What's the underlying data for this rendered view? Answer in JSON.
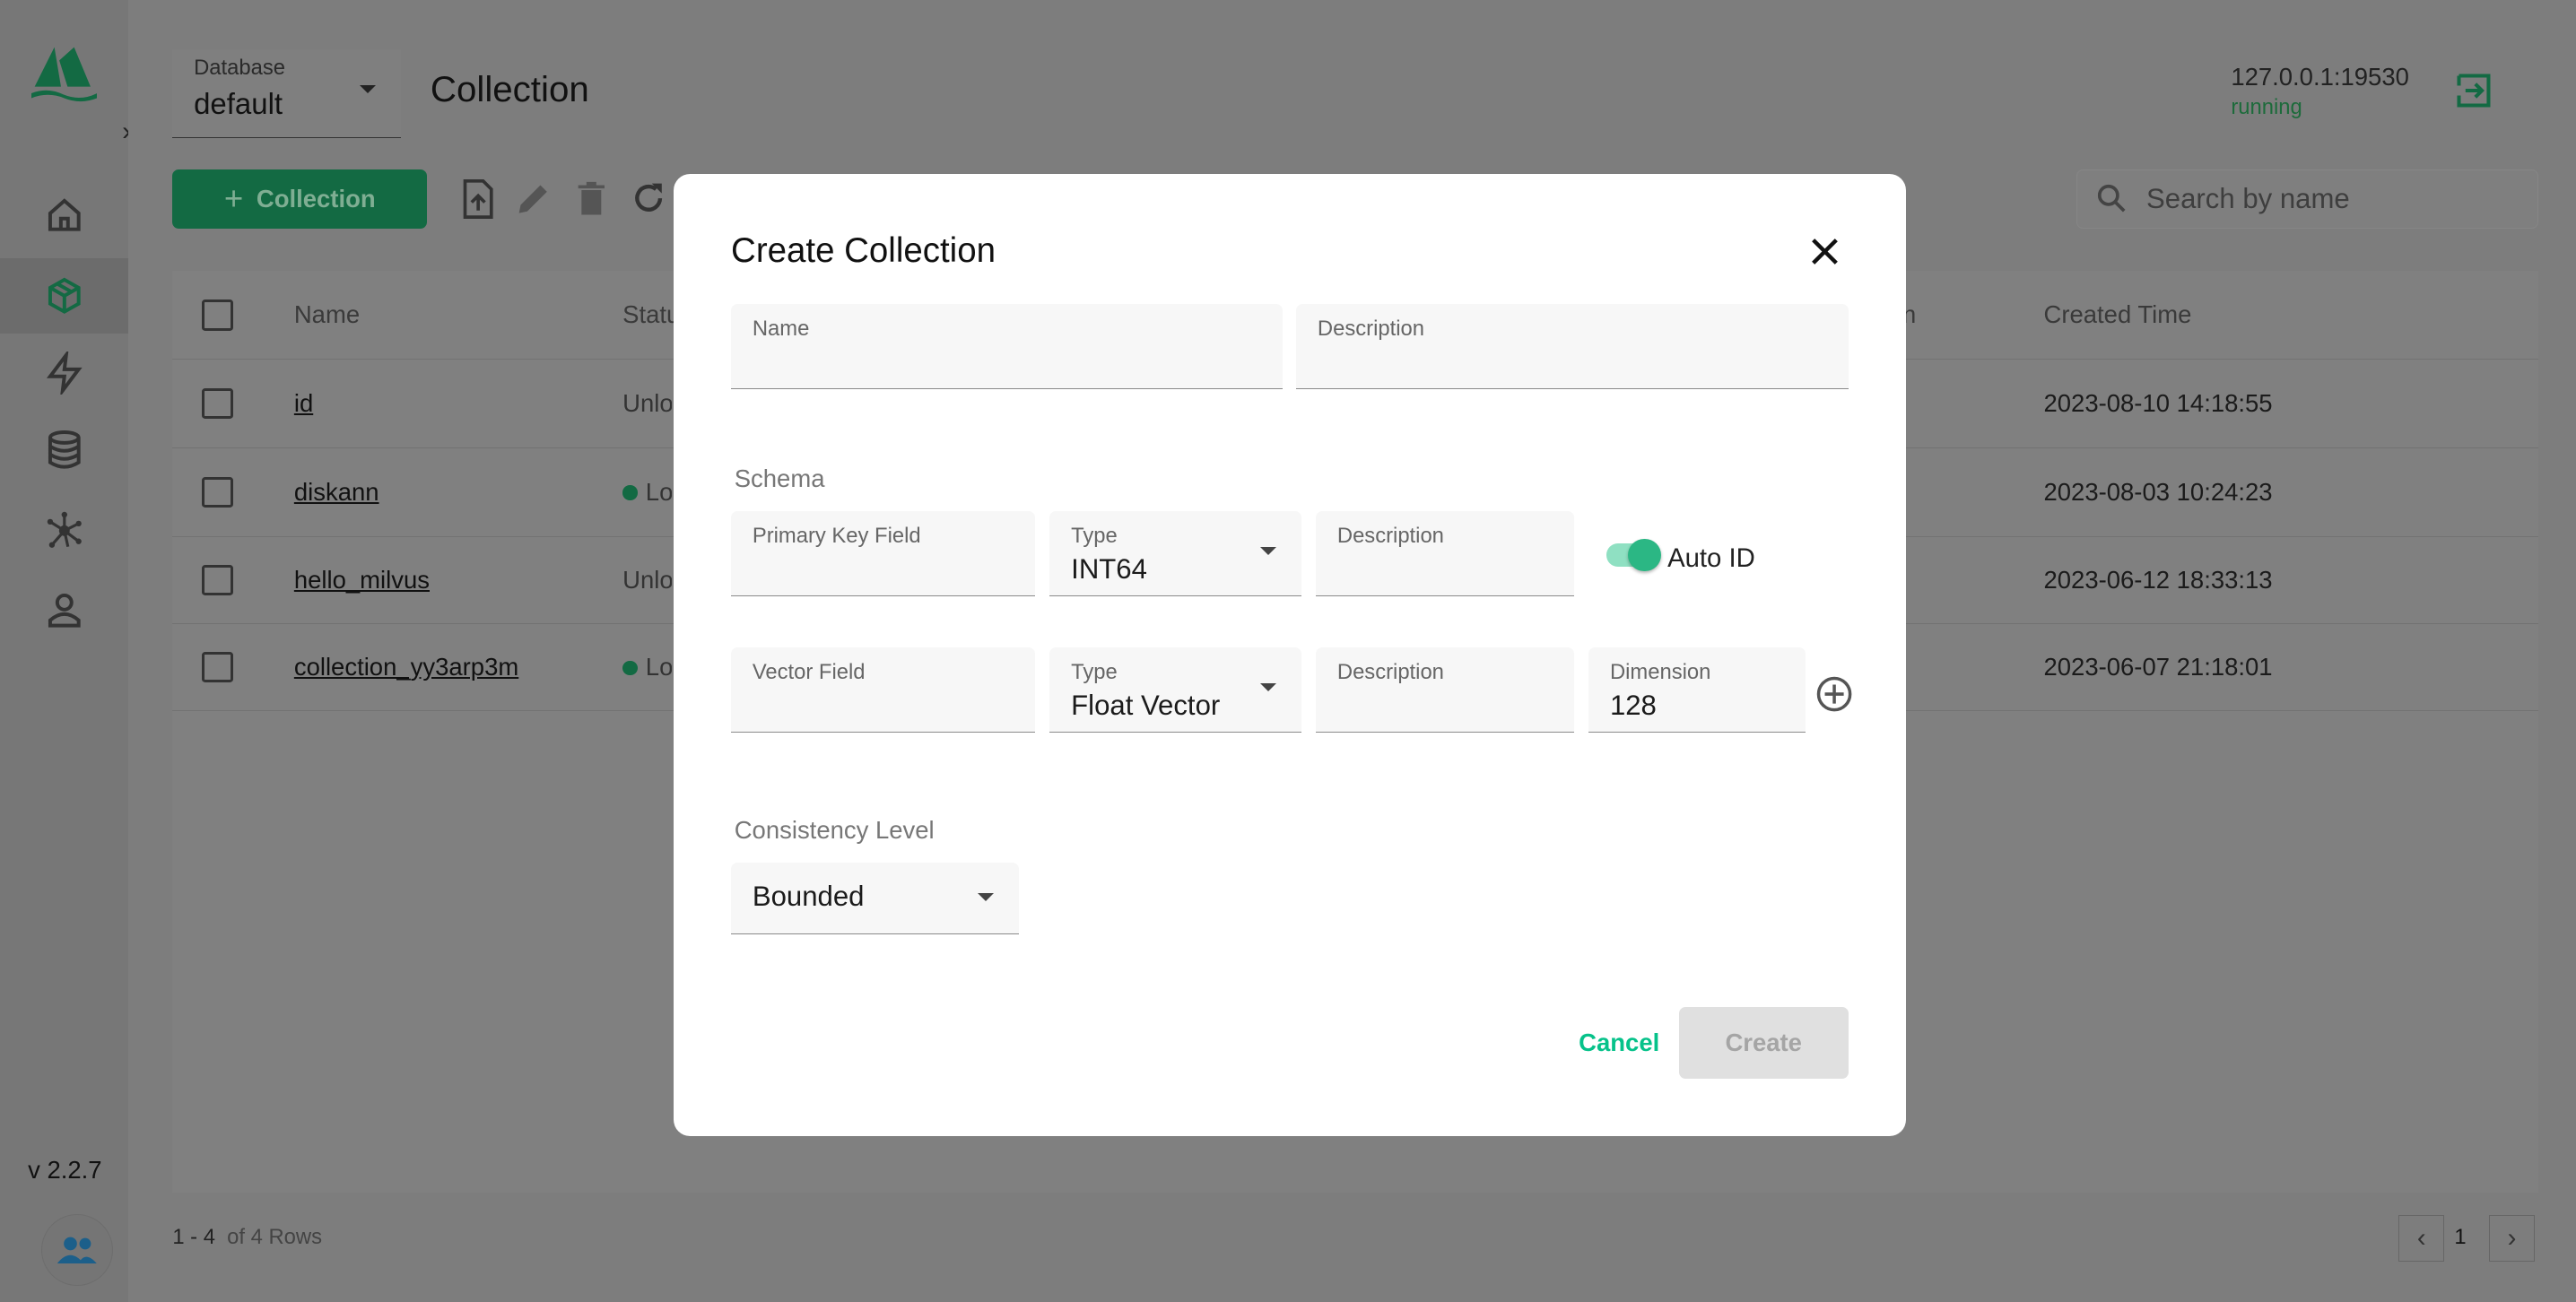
{
  "sidebar": {
    "version": "v 2.2.7",
    "items": [
      "home",
      "collection",
      "search",
      "database",
      "system",
      "user"
    ]
  },
  "header": {
    "database_label": "Database",
    "database_value": "default",
    "title": "Collection",
    "address": "127.0.0.1:19530",
    "status": "running"
  },
  "toolbar": {
    "add_label": "Collection",
    "search_placeholder": "Search by name"
  },
  "table": {
    "headers": {
      "name": "Name",
      "status": "Statu",
      "partial": "n",
      "created": "Created Time"
    },
    "rows": [
      {
        "name": "id",
        "status": "Unlo",
        "loaded": false,
        "created": "2023-08-10 14:18:55"
      },
      {
        "name": "diskann",
        "status": "Lo",
        "loaded": true,
        "created": "2023-08-03 10:24:23"
      },
      {
        "name": "hello_milvus",
        "status": "Unlo",
        "loaded": false,
        "created": "2023-06-12 18:33:13"
      },
      {
        "name": "collection_yy3arp3m",
        "status": "Lo",
        "loaded": true,
        "created": "2023-06-07 21:18:01"
      }
    ]
  },
  "footer": {
    "range": "1 - 4",
    "total": "of 4 Rows",
    "page": "1"
  },
  "modal": {
    "title": "Create Collection",
    "name_label": "Name",
    "name_value": "",
    "desc_label": "Description",
    "desc_value": "",
    "schema_label": "Schema",
    "pk_label": "Primary Key Field",
    "pk_value": "",
    "pk_type_label": "Type",
    "pk_type": "INT64",
    "pk_desc_label": "Description",
    "auto_id_label": "Auto ID",
    "auto_id": true,
    "vec_label": "Vector Field",
    "vec_value": "",
    "vec_type_label": "Type",
    "vec_type": "Float Vector",
    "vec_desc_label": "Description",
    "dim_label": "Dimension",
    "dim_value": "128",
    "consistency_label": "Consistency Level",
    "consistency_value": "Bounded",
    "cancel": "Cancel",
    "create": "Create"
  },
  "colors": {
    "accent": "#06c28a",
    "brand": "#136a43",
    "running": "#1d7a3e"
  }
}
